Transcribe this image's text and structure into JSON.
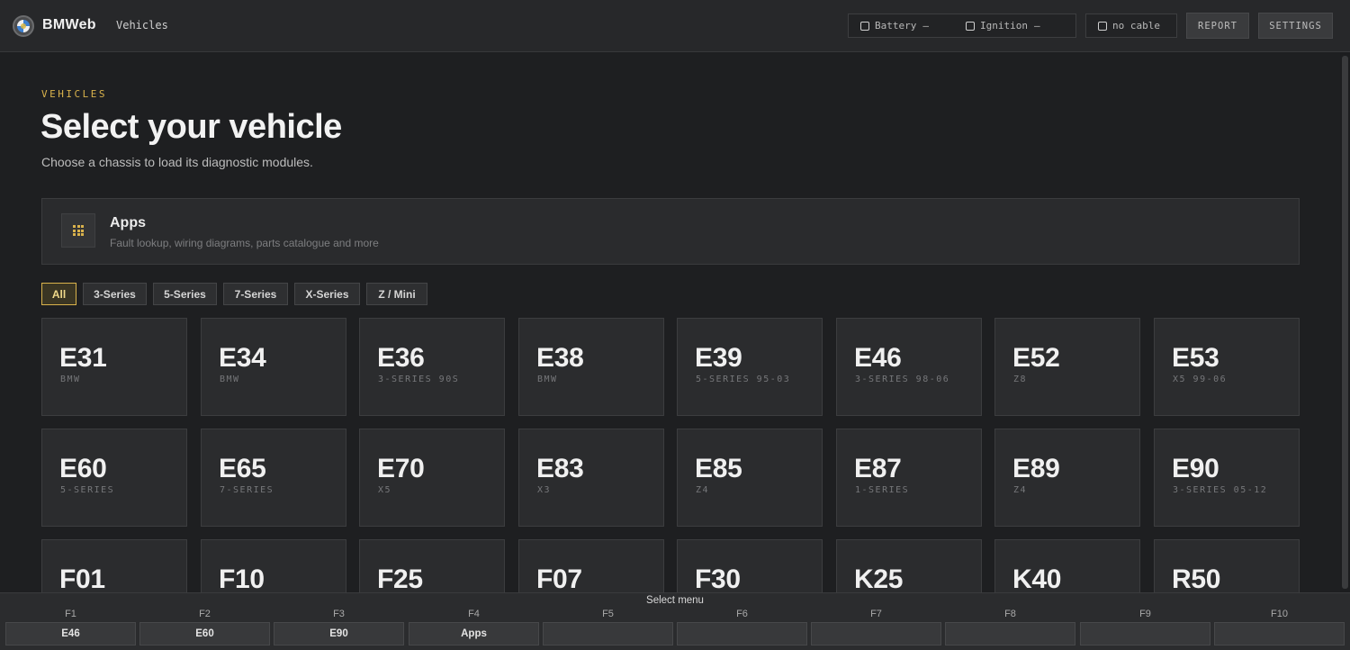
{
  "header": {
    "brand": "BMWeb",
    "nav_vehicles": "Vehicles",
    "battery_label": "Battery",
    "battery_value": "–",
    "ignition_label": "Ignition",
    "ignition_value": "–",
    "cable_label": "no cable",
    "report_label": "REPORT",
    "settings_label": "SETTINGS"
  },
  "page": {
    "eyebrow": "VEHICLES",
    "title": "Select your vehicle",
    "subtitle": "Choose a chassis to load its diagnostic modules."
  },
  "apps": {
    "title": "Apps",
    "description": "Fault lookup, wiring diagrams, parts catalogue and more"
  },
  "filters": [
    "All",
    "3-Series",
    "5-Series",
    "7-Series",
    "X-Series",
    "Z / Mini"
  ],
  "vehicles": [
    {
      "code": "E31",
      "sub": "BMW"
    },
    {
      "code": "E34",
      "sub": "BMW"
    },
    {
      "code": "E36",
      "sub": "3-SERIES 90S"
    },
    {
      "code": "E38",
      "sub": "BMW"
    },
    {
      "code": "E39",
      "sub": "5-SERIES 95-03"
    },
    {
      "code": "E46",
      "sub": "3-SERIES 98-06"
    },
    {
      "code": "E52",
      "sub": "Z8"
    },
    {
      "code": "E53",
      "sub": "X5 99-06"
    },
    {
      "code": "E60",
      "sub": "5-SERIES"
    },
    {
      "code": "E65",
      "sub": "7-SERIES"
    },
    {
      "code": "E70",
      "sub": "X5"
    },
    {
      "code": "E83",
      "sub": "X3"
    },
    {
      "code": "E85",
      "sub": "Z4"
    },
    {
      "code": "E87",
      "sub": "1-SERIES"
    },
    {
      "code": "E89",
      "sub": "Z4"
    },
    {
      "code": "E90",
      "sub": "3-SERIES 05-12"
    },
    {
      "code": "F01",
      "sub": ""
    },
    {
      "code": "F10",
      "sub": ""
    },
    {
      "code": "F25",
      "sub": ""
    },
    {
      "code": "F07",
      "sub": ""
    },
    {
      "code": "F30",
      "sub": ""
    },
    {
      "code": "K25",
      "sub": ""
    },
    {
      "code": "K40",
      "sub": ""
    },
    {
      "code": "R50",
      "sub": ""
    }
  ],
  "fbar": {
    "title": "Select menu",
    "keys": [
      {
        "key": "F1",
        "label": "E46"
      },
      {
        "key": "F2",
        "label": "E60"
      },
      {
        "key": "F3",
        "label": "E90"
      },
      {
        "key": "F4",
        "label": "Apps"
      },
      {
        "key": "F5",
        "label": ""
      },
      {
        "key": "F6",
        "label": ""
      },
      {
        "key": "F7",
        "label": ""
      },
      {
        "key": "F8",
        "label": ""
      },
      {
        "key": "F9",
        "label": ""
      },
      {
        "key": "F10",
        "label": ""
      }
    ]
  },
  "colors": {
    "accent": "#d9b24c",
    "background": "#1e1f21",
    "tile": "#2b2c2e"
  }
}
